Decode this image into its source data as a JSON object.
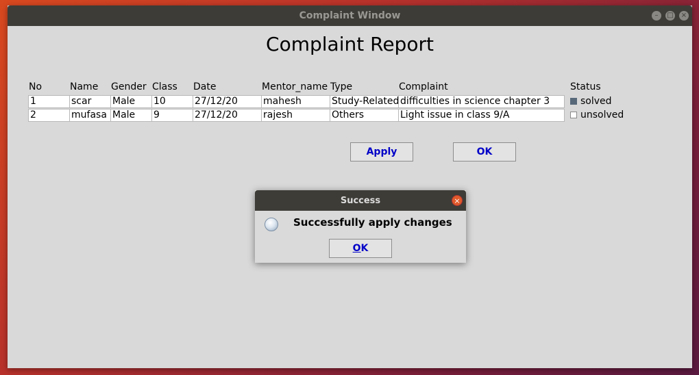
{
  "window": {
    "title": "Complaint Window"
  },
  "heading": "Complaint Report",
  "columns": [
    "No",
    "Name",
    "Gender",
    "Class",
    "Date",
    "Mentor_name",
    "Type",
    "Complaint",
    "Status"
  ],
  "rows": [
    {
      "no": "1",
      "name": "scar",
      "gender": "Male",
      "class": "10",
      "date": "27/12/20",
      "mentor": "mahesh",
      "type": "Study-Related",
      "complaint": "difficulties in science chapter 3",
      "status": "solved",
      "checked": true
    },
    {
      "no": "2",
      "name": "mufasa",
      "gender": "Male",
      "class": "9",
      "date": "27/12/20",
      "mentor": "rajesh",
      "type": "Others",
      "complaint": "Light issue in class 9/A",
      "status": "unsolved",
      "checked": false
    }
  ],
  "buttons": {
    "apply": "Apply",
    "ok": "OK"
  },
  "dialog": {
    "title": "Success",
    "message": "Successfully apply changes",
    "ok_first": "O",
    "ok_rest": "K",
    "icon": "info-icon"
  },
  "colors": {
    "link_blue": "#0000c8",
    "titlebar": "#3e3c37",
    "close_red": "#e05a2b"
  }
}
